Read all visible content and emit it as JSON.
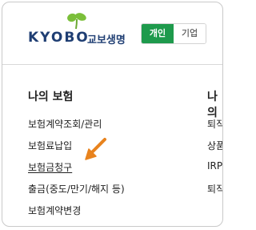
{
  "brand": {
    "name_en": "KYOBO",
    "name_kr": "교보생명"
  },
  "toggle": {
    "personal": "개인",
    "corporate": "기업",
    "active": "personal"
  },
  "colors": {
    "brand_green": "#1e9a4c",
    "brand_navy": "#1f3e73",
    "arrow": "#e8831e"
  },
  "menu": {
    "my_insurance": {
      "title": "나의 보험",
      "items": [
        "보험계약조회/관리",
        "보험료납입",
        "보험금청구",
        "출금(중도/만기/해지 등)",
        "보험계약변경"
      ]
    },
    "second_column": {
      "title": "나의",
      "items": [
        "퇴직",
        "상품",
        "IRP",
        "퇴직"
      ]
    }
  },
  "icons": {
    "logo_sprout": "sprout-icon",
    "pointer": "pointer-arrow-icon"
  }
}
